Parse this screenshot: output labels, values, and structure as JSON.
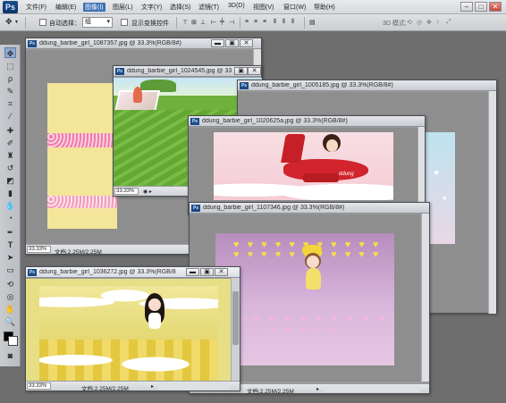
{
  "app": {
    "logo": "Ps",
    "menus": [
      "文件(F)",
      "编辑(E)",
      "图像(I)",
      "图层(L)",
      "文字(Y)",
      "选择(S)",
      "滤镜(T)",
      "3D(D)",
      "视图(V)",
      "窗口(W)",
      "帮助(H)"
    ],
    "active_menu": "图像(I)",
    "mode_3d": "3D 模式:"
  },
  "options": {
    "auto_select_label": "自动选择：",
    "auto_select_value": "组",
    "show_transform_label": "显示变换控件"
  },
  "windows": [
    {
      "title": "ddung_barbie_girl_1087357.jpg @ 33.3%(RGB/8#)",
      "zoom": "33.33%",
      "doc_info": ""
    },
    {
      "title": "ddung_barbie_girl_1024545.jpg @ 33.3%(RGB/8#)",
      "zoom": "33.33%",
      "doc_info": ""
    },
    {
      "title": "ddung_barbie_girl_1005185.jpg @ 33.3%(RGB/8#)",
      "zoom": "",
      "doc_info": ""
    },
    {
      "title": "ddung_barbie_girl_1020625a.jpg @ 33.3%(RGB/8#)",
      "zoom": "",
      "doc_info": ""
    },
    {
      "title": "ddung_barbie_girl_1107346.jpg @ 33.3%(RGB/8#)",
      "zoom": "",
      "doc_info": "文档:2.25M/2.25M"
    },
    {
      "title": "ddung_barbie_girl_1036272.jpg @ 33.3%(RGB/8",
      "zoom": "33.33%",
      "doc_info": "文档:2.25M/2.25M"
    }
  ],
  "first_window_zoom": "33.33%",
  "first_window_docinfo": "文档:2.25M/2.25M",
  "plane_text": "ddung",
  "colors": {
    "accent": "#3c6fb3",
    "canvas_bg": "#6e6e6e"
  }
}
